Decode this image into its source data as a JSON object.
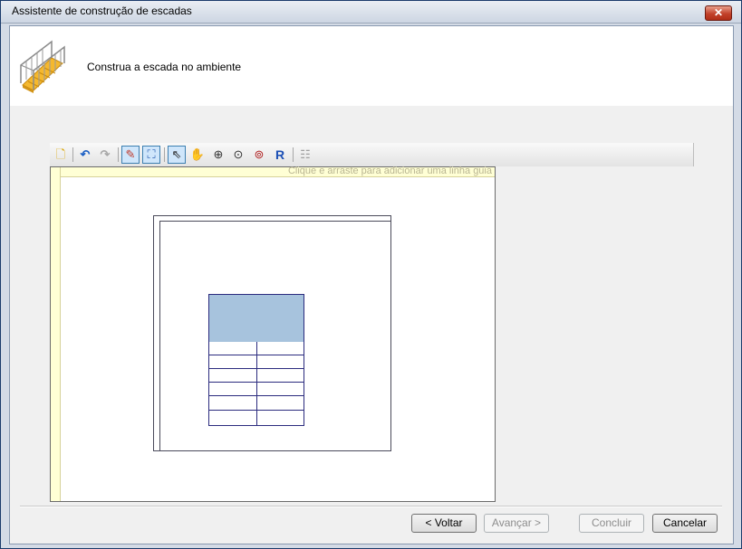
{
  "window": {
    "title": "Assistente de construção de escadas",
    "close_label": "✕"
  },
  "header": {
    "instruction": "Construa a escada no ambiente",
    "icon": "staircase-icon"
  },
  "toolbar": {
    "buttons": [
      {
        "name": "new-icon",
        "glyph": "🗋"
      },
      {
        "name": "undo-icon",
        "glyph": "↶"
      },
      {
        "name": "redo-icon",
        "glyph": "↷"
      },
      {
        "name": "draw-wall-icon",
        "glyph": "✎"
      },
      {
        "name": "draw-stair-icon",
        "glyph": "⛶"
      },
      {
        "name": "select-pointer-icon",
        "glyph": "⇖"
      },
      {
        "name": "pan-hand-icon",
        "glyph": "✋"
      },
      {
        "name": "zoom-in-out-icon",
        "glyph": "⊕"
      },
      {
        "name": "zoom-window-icon",
        "glyph": "⊙"
      },
      {
        "name": "zoom-extents-icon",
        "glyph": "⊚"
      },
      {
        "name": "redraw-icon",
        "glyph": "R"
      },
      {
        "name": "properties-icon",
        "glyph": "☷"
      }
    ]
  },
  "canvas": {
    "guide_hint": "Clique e arraste para adicionar uma linha guia"
  },
  "footer": {
    "back_label": "< Voltar",
    "next_label": "Avançar >",
    "finish_label": "Concluir",
    "cancel_label": "Cancelar"
  },
  "colors": {
    "landing_fill": "#a7c3dd",
    "stair_stroke": "#2b2b7e",
    "ruler": "#ffffd5"
  }
}
